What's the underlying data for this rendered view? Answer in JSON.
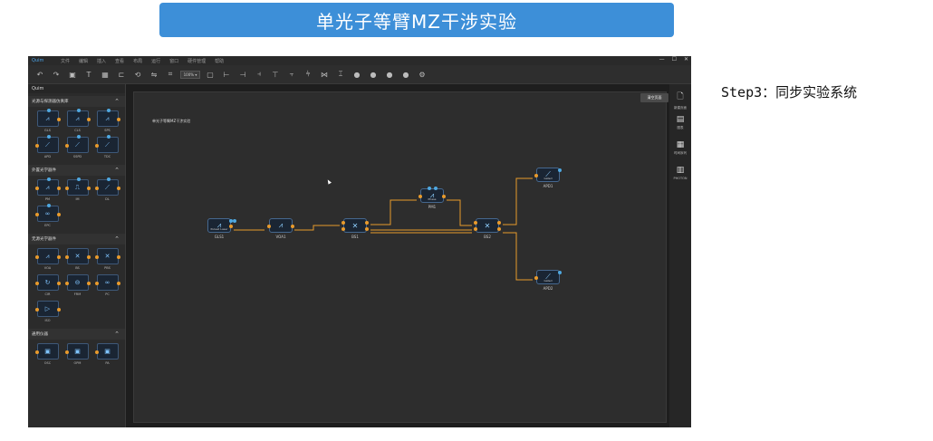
{
  "banner": {
    "title": "单光子等臂MZ干涉实验"
  },
  "step_note": "Step3：同步实验系统",
  "app": {
    "logo": "Quim",
    "menu": [
      "文件",
      "编辑",
      "插入",
      "查看",
      "布局",
      "运行",
      "窗口",
      "硬件管理",
      "帮助"
    ],
    "window_controls": [
      "—",
      "☐",
      "✕"
    ],
    "toolbar": {
      "icons": [
        "undo-icon",
        "redo-icon",
        "image-icon",
        "text-icon",
        "grid-icon",
        "align-icon",
        "rotate-icon",
        "flip-icon",
        "crop-icon"
      ],
      "zoom": "100% ▾",
      "icons2": [
        "frame-icon",
        "align-left-icon",
        "align-right-icon",
        "align-center-icon",
        "align-top-icon",
        "align-middle-icon",
        "distribute-h-icon",
        "distribute-v-icon",
        "spacing-icon",
        "stop-icon",
        "circle-icon",
        "record-icon",
        "pause-icon",
        "settings-icon"
      ]
    },
    "sidebar": {
      "header": "Quim",
      "sections": [
        {
          "title": "光源与探测器仿真库",
          "items": [
            {
              "label": "GLS",
              "icon": "⩘",
              "caption": "Pulsed Laser"
            },
            {
              "label": "CLS",
              "icon": "⩘",
              "caption": "Continuous"
            },
            {
              "label": "SPS",
              "icon": "⩘",
              "caption": "Single Photon"
            },
            {
              "label": "APD",
              "icon": "⟋",
              "caption": "Gated"
            },
            {
              "label": "SSPD",
              "icon": "⟋",
              "caption": "Power Detector"
            },
            {
              "label": "TDC",
              "icon": "⟋",
              "caption": "Time-to-Digital"
            }
          ]
        },
        {
          "title": "外置光学器件",
          "items": [
            {
              "label": "PM",
              "icon": "⩘",
              "caption": "Phase"
            },
            {
              "label": "IM",
              "icon": "⎍",
              "caption": ""
            },
            {
              "label": "DL",
              "icon": "⟋",
              "caption": ""
            },
            {
              "label": "EPC",
              "icon": "∞",
              "caption": "Module"
            }
          ]
        },
        {
          "title": "无源光学器件",
          "items": [
            {
              "label": "VOA",
              "icon": "⩘",
              "caption": ""
            },
            {
              "label": "BS",
              "icon": "✕",
              "caption": ""
            },
            {
              "label": "PBS",
              "icon": "✕",
              "caption": ""
            },
            {
              "label": "CIR",
              "icon": "↻",
              "caption": ""
            },
            {
              "label": "FRM",
              "icon": "⊖",
              "caption": ""
            },
            {
              "label": "PC",
              "icon": "∞",
              "caption": ""
            },
            {
              "label": "ISO",
              "icon": "▷",
              "caption": ""
            }
          ]
        },
        {
          "title": "通用仪器",
          "items": [
            {
              "label": "OSC",
              "icon": "▣",
              "caption": ""
            },
            {
              "label": "OPM",
              "icon": "▣",
              "caption": ""
            },
            {
              "label": "PA",
              "icon": "▣",
              "caption": ""
            }
          ]
        }
      ]
    },
    "canvas": {
      "title": "单光子等臂MZ干涉实验",
      "clear_button": "清空页面",
      "nodes": {
        "gls1": {
          "label": "GLS1",
          "icon": "⩘",
          "sub": "Pulsed Laser"
        },
        "voa1": {
          "label": "VOA1",
          "icon": "⩘",
          "sub": ""
        },
        "bs1": {
          "label": "BS1",
          "icon": "✕",
          "sub": ""
        },
        "pm1": {
          "label": "PM1",
          "icon": "⩘",
          "sub": "Phase"
        },
        "bs2": {
          "label": "BS2",
          "icon": "✕",
          "sub": ""
        },
        "apd1": {
          "label": "APD1",
          "icon": "⟋",
          "sub": "Gated"
        },
        "apd2": {
          "label": "APD2",
          "icon": "⟋",
          "sub": "Gated"
        }
      },
      "wire_color": "#e89a2c"
    },
    "rightbar": [
      {
        "icon": "page-icon",
        "label": "新建页面"
      },
      {
        "icon": "chart-icon",
        "label": "图表"
      },
      {
        "icon": "calendar-icon",
        "label": "时间序列"
      },
      {
        "icon": "doc-icon",
        "label": "PHOTON"
      }
    ]
  }
}
